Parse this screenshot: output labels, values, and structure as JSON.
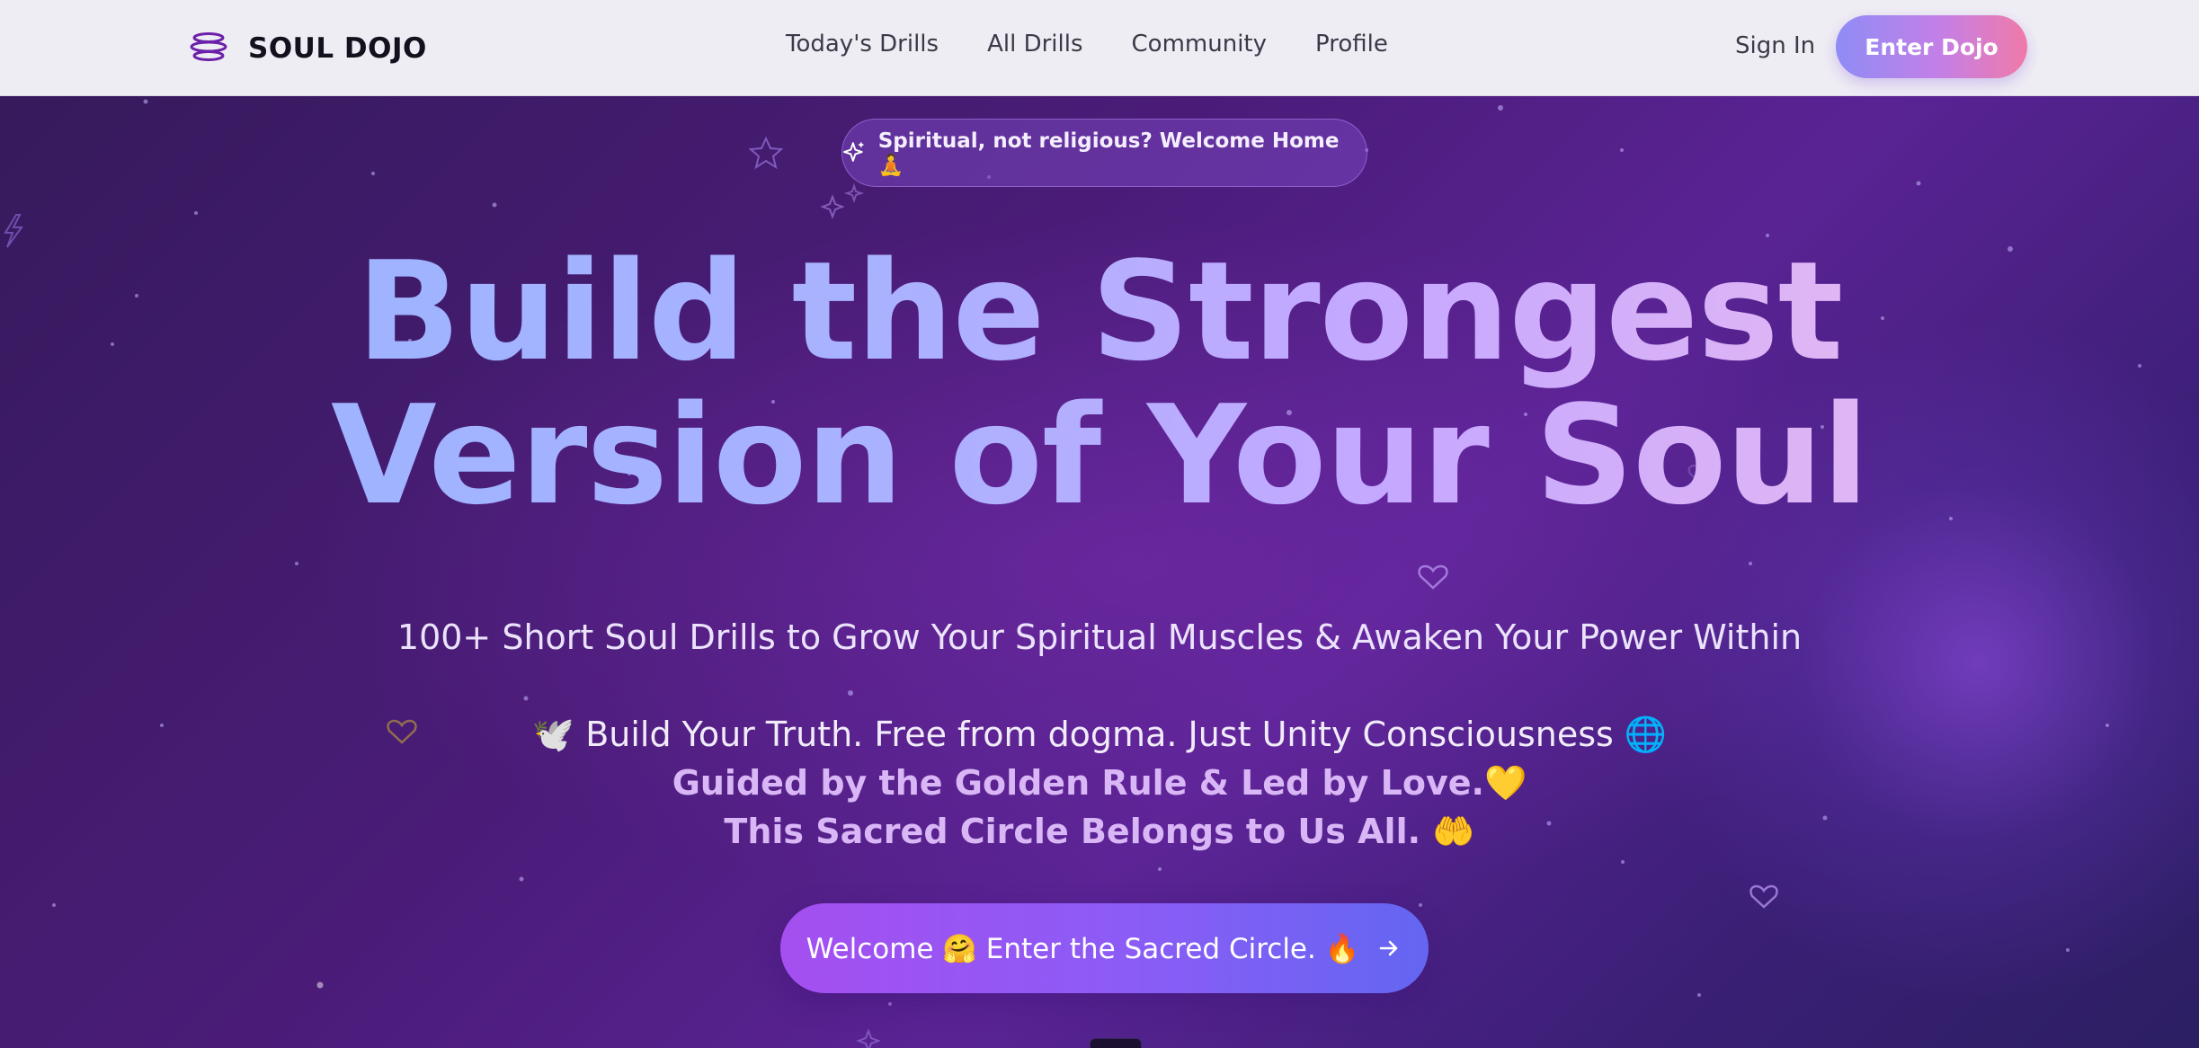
{
  "brand": {
    "name": "SOUL DOJO",
    "icon": "stacked-rings-icon",
    "accent": "#6b21a8"
  },
  "nav": {
    "links": [
      "Today's Drills",
      "All Drills",
      "Community",
      "Profile"
    ],
    "sign_in": "Sign In",
    "enter_dojo": "Enter Dojo"
  },
  "hero": {
    "badge_icon": "sparkles-icon",
    "badge": "Spiritual, not religious? Welcome Home 🧘",
    "headline_line1": "Build the Strongest",
    "headline_line2": "Version of Your Soul",
    "subtitle": "100+ Short Soul Drills to Grow Your Spiritual Muscles & Awaken Your Power Within",
    "line1": "🕊️ Build Your Truth. Free from dogma. Just Unity Consciousness 🌐",
    "line2": "Guided by the Golden Rule & Led by Love.💛",
    "line3": "This Sacred Circle Belongs to Us All. 🤲",
    "cta": "Welcome 🤗 Enter the Sacred Circle. 🔥",
    "cta_icon": "arrow-right-icon",
    "decor_icons": [
      "star-icon",
      "heart-icon",
      "sparkle-icon",
      "lightning-icon"
    ]
  },
  "colors": {
    "hero_bg": "#4a1c78",
    "headline_gradient_start": "#9fb3ff",
    "headline_gradient_end": "#e0b6f4",
    "cta_start": "#a54ff0",
    "cta_end": "#6366f1",
    "enter_dojo_start": "#8f8cf6",
    "enter_dojo_end": "#f07aa8"
  }
}
